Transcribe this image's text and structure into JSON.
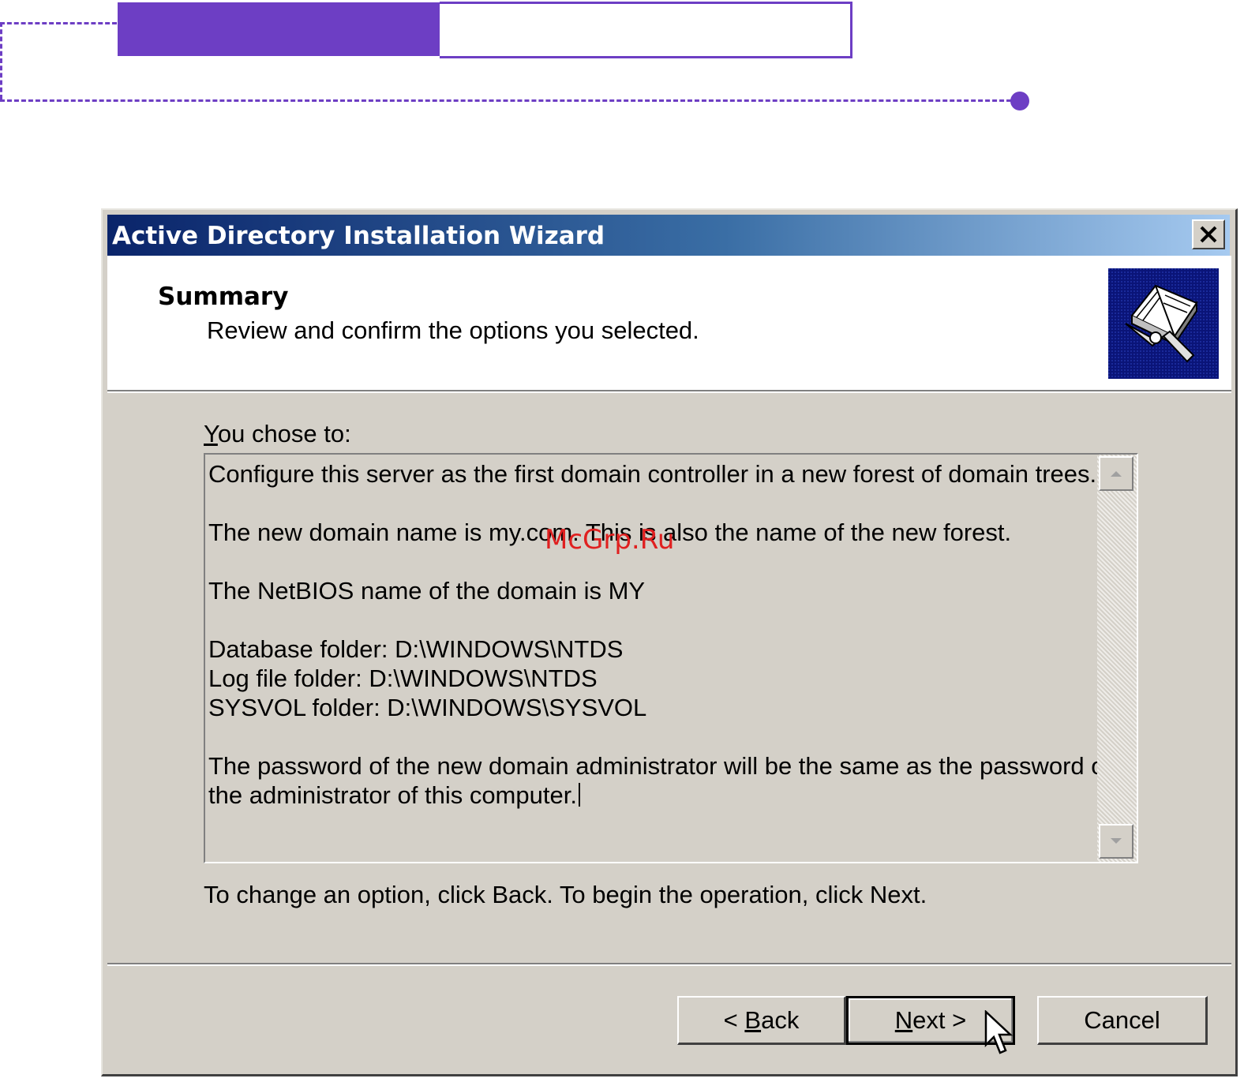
{
  "dialog": {
    "title": "Active Directory Installation Wizard",
    "close_label": "×"
  },
  "header": {
    "title": "Summary",
    "subtitle": "Review and confirm the options you selected."
  },
  "body": {
    "label_prefix": "Y",
    "label_rest": "ou chose to:",
    "lines": [
      "Configure this server as the first domain controller in a new forest of domain trees.",
      "The new domain name is my.com. This is also the name of the new forest.",
      "The NetBIOS name of the domain is MY",
      "Database folder: D:\\WINDOWS\\NTDS",
      "Log file folder: D:\\WINDOWS\\NTDS",
      "SYSVOL folder: D:\\WINDOWS\\SYSVOL",
      "The password of the new domain administrator will be the same as the password of",
      "the administrator of this computer."
    ],
    "instruction": "To change an option, click Back. To begin the operation, click Next."
  },
  "buttons": {
    "back_prefix": "< ",
    "back_mnemonic": "B",
    "back_rest": "ack",
    "next_mnemonic": "N",
    "next_rest": "ext >",
    "cancel": "Cancel"
  },
  "watermark": "McGrp.Ru",
  "icons": {
    "close": "close-icon",
    "wizard": "directory-book-icon",
    "scroll_up": "arrow-up-icon",
    "scroll_down": "arrow-down-icon",
    "cursor": "mouse-pointer-icon"
  },
  "colors": {
    "accent": "#6d3ec4",
    "titlebar_start": "#0a246a",
    "titlebar_end": "#a6caf0",
    "dialog_face": "#d4d0c8",
    "icon_bg": "#0a1478",
    "watermark": "#e02020"
  }
}
